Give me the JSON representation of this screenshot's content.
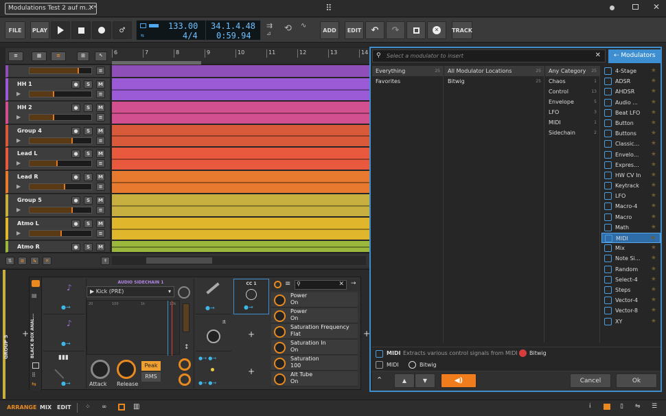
{
  "window": {
    "tab_title": "Modulations Test 2 auf m...",
    "tab_modified": "*",
    "close": "✕",
    "logo": "⠿"
  },
  "toolbar": {
    "file": "FILE",
    "play": "PLAY",
    "add": "ADD",
    "edit": "EDIT",
    "track": "TRACK",
    "tempo": "133.00",
    "signature": "4/4",
    "position": "34.1.4.48",
    "time": "0:59.94"
  },
  "ruler": {
    "marks": [
      "6",
      "7",
      "8",
      "9",
      "10",
      "11",
      "12",
      "13",
      "14"
    ]
  },
  "tracks": [
    {
      "name": "",
      "color": "#8f4fb8",
      "volume": 0.8
    },
    {
      "name": "HH 1",
      "color": "#9c5bd6",
      "volume": 0.4
    },
    {
      "name": "HH 2",
      "color": "#d2508f",
      "volume": 0.4
    },
    {
      "name": "Group 4",
      "color": "#d95a3a",
      "volume": 0.7
    },
    {
      "name": "Lead L",
      "color": "#e8593e",
      "volume": 0.45
    },
    {
      "name": "Lead R",
      "color": "#e87a2f",
      "volume": 0.58
    },
    {
      "name": "Group 5",
      "color": "#c8b040",
      "volume": 0.7
    },
    {
      "name": "Atmo L",
      "color": "#e0b62d",
      "volume": 0.52
    },
    {
      "name": "Atmo R",
      "color": "#9bb83c",
      "volume": 0.5
    }
  ],
  "browser": {
    "search_placeholder": "Select a modulator to insert",
    "tab": "Modulators",
    "col1": [
      {
        "label": "Everything",
        "count": "25"
      },
      {
        "label": "Favorites",
        "count": ""
      }
    ],
    "col2": [
      {
        "label": "All Modulator Locations",
        "count": "25"
      },
      {
        "label": "Bitwig",
        "count": "25"
      }
    ],
    "col3": [
      {
        "label": "Any Category",
        "count": "25"
      },
      {
        "label": "Chaos",
        "count": "1"
      },
      {
        "label": "Control",
        "count": "13"
      },
      {
        "label": "Envelope",
        "count": "5"
      },
      {
        "label": "LFO",
        "count": "3"
      },
      {
        "label": "MIDI",
        "count": "1"
      },
      {
        "label": "Sidechain",
        "count": "2"
      }
    ],
    "modulators": [
      "4-Stage",
      "ADSR",
      "AHDSR",
      "Audio ...",
      "Beat LFO",
      "Button",
      "Buttons",
      "Classic...",
      "Envelo...",
      "Expres...",
      "HW CV In",
      "Keytrack",
      "LFO",
      "Macro-4",
      "Macro",
      "Math",
      "MIDI",
      "Mix",
      "Note Si...",
      "Random",
      "Select-4",
      "Steps",
      "Vector-4",
      "Vector-8",
      "XY"
    ],
    "selected": "MIDI",
    "info_name": "MIDI",
    "info_desc": "Extracts various control signals from MIDI ...",
    "info_vendor": "Bitwig",
    "info_type": "MIDI",
    "info_creator": "Bitwig",
    "cancel": "Cancel",
    "ok": "Ok"
  },
  "device": {
    "group": "GROUP 5",
    "chain": "BLACK BOX ANAL...",
    "sidechain_title": "AUDIO SIDECHAIN 1",
    "source": "Kick (PRE)",
    "attack": "Attack",
    "release": "Release",
    "peak": "Peak",
    "rms": "RMS",
    "cc": "CC 1",
    "freq_ticks": [
      "20",
      "100",
      "1k",
      "10k"
    ],
    "params": [
      {
        "name": "Power",
        "value": "On"
      },
      {
        "name": "Power",
        "value": "On"
      },
      {
        "name": "Saturation Frequency",
        "value": "Flat"
      },
      {
        "name": "Saturation In",
        "value": "On"
      },
      {
        "name": "Saturation",
        "value": "100"
      },
      {
        "name": "Alt Tube",
        "value": "On"
      }
    ]
  },
  "bottom": {
    "arrange": "ARRANGE",
    "mix": "MIX",
    "edit": "EDIT"
  }
}
